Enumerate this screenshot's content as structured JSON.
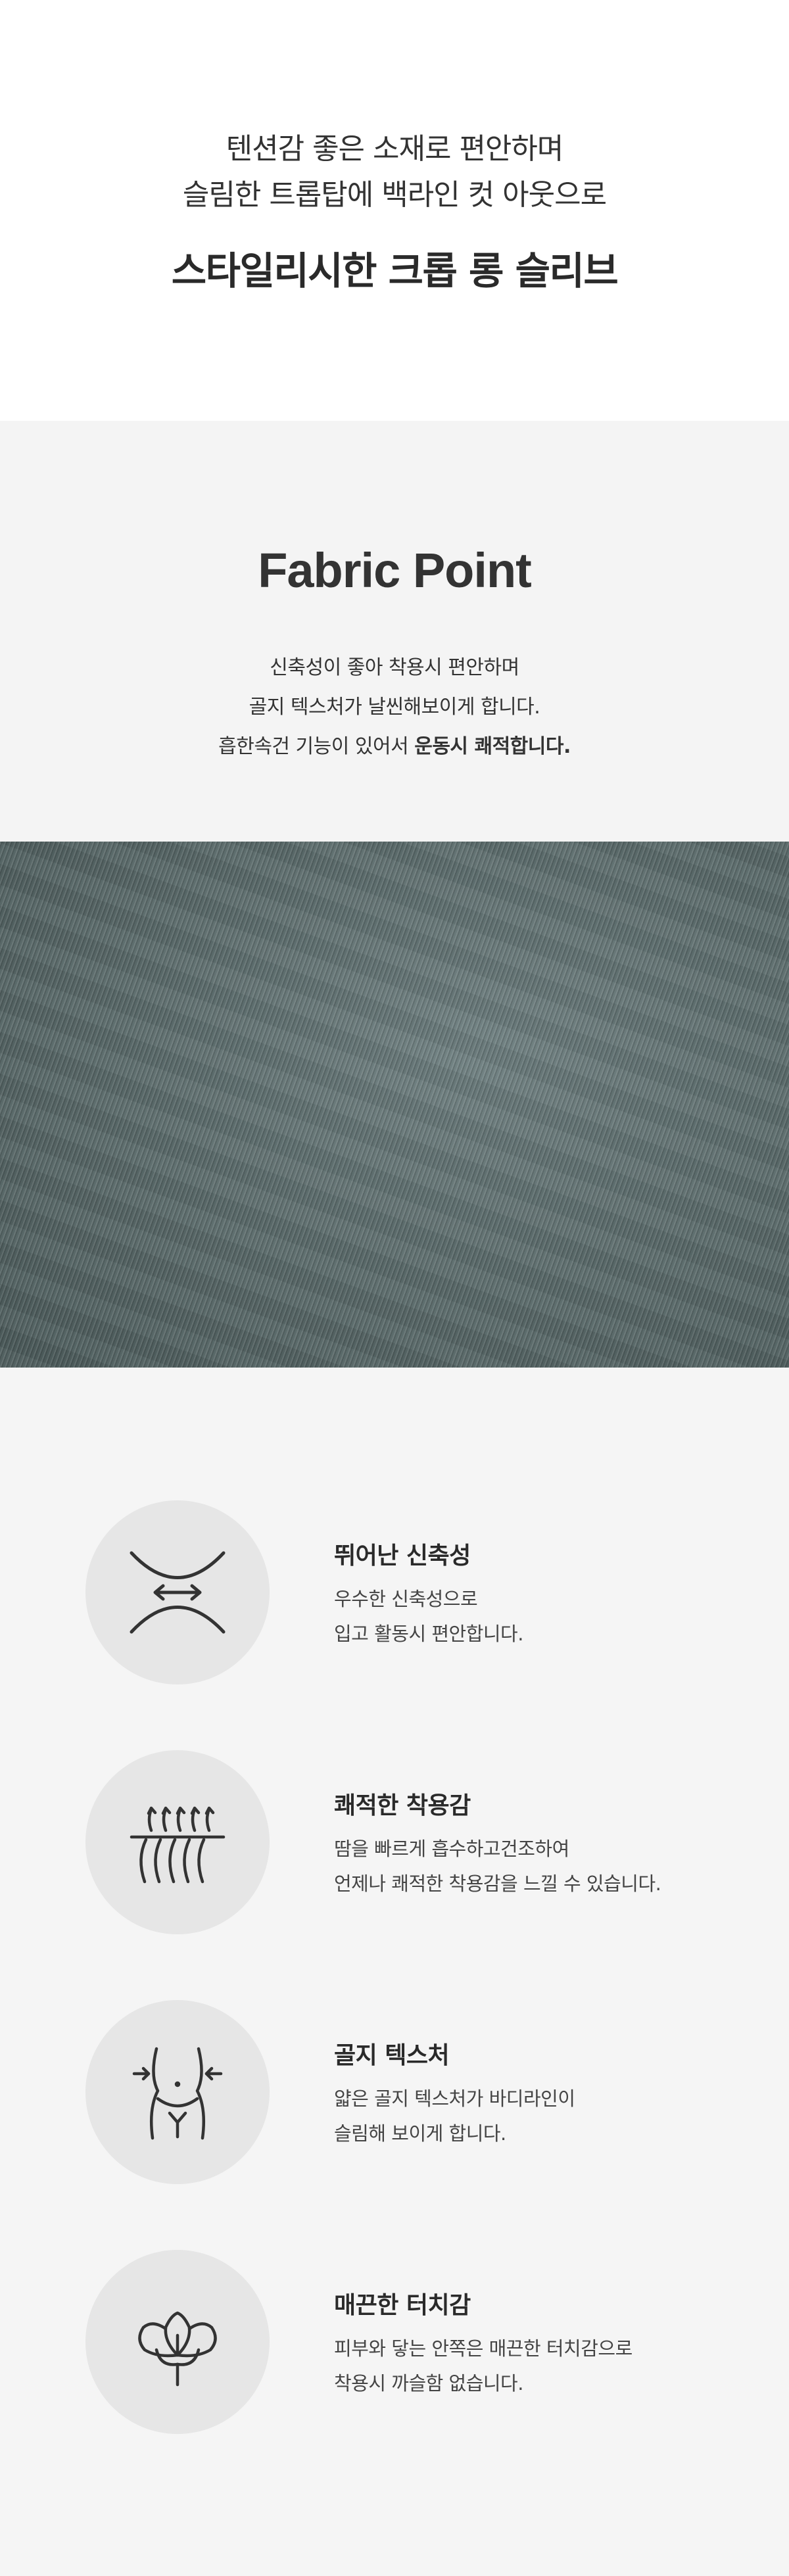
{
  "hero": {
    "line1": "텐션감 좋은 소재로 편안하며",
    "line2": "슬림한 트롭탑에 백라인 컷 아웃으로",
    "title": "스타일리시한 크롭 롱 슬리브"
  },
  "fabric": {
    "title": "Fabric Point",
    "line1": "신축성이 좋아 착용시 편안하며",
    "line2": "골지 텍스처가 날씬해보이게 합니다.",
    "line3_prefix": "흡한속건 기능이 있어서 ",
    "line3_bold": "운동시 쾌적합니다."
  },
  "features": [
    {
      "icon": "stretch-icon",
      "title": "뛰어난 신축성",
      "line1": "우수한 신축성으로",
      "line2": "입고 활동시 편안합니다."
    },
    {
      "icon": "moisture-wicking-icon",
      "title": "쾌적한 착용감",
      "line1": "땀을 빠르게 흡수하고건조하여",
      "line2": "언제나 쾌적한 착용감을 느낄 수 있습니다."
    },
    {
      "icon": "slim-waist-icon",
      "title": "골지 텍스처",
      "line1": "얇은 골지 텍스처가 바디라인이",
      "line2": "슬림해 보이게 합니다."
    },
    {
      "icon": "cotton-flower-icon",
      "title": "매끈한 터치감",
      "line1": "피부와 닿는 안쪽은 매끈한 터치감으로",
      "line2": "착용시 까슬함 없습니다."
    }
  ]
}
